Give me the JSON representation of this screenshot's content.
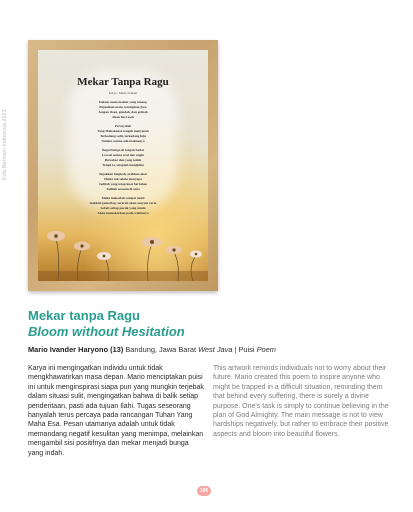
{
  "side_label": "Kids Bermain Indonesia 2023",
  "poster": {
    "title": "Mekar Tanpa Ragu",
    "byline": "Karya : Mario Ivander",
    "stanzas": [
      [
        "Dalam suatu malam yang tenang",
        "Pujanikan mata, tenangkan jiwa",
        "Jangan risau, gundah, dan gelisah",
        "Akan hari esok"
      ],
      [
        "Percayalah",
        "Yang Mahakuasa tengah menyusun",
        "Terkadang sulit, terkadang lulu",
        "Namun semua ada maknanya"
      ],
      [
        "Bagai bunga di tengah badai",
        "Lewati semua aral dan angin",
        "Bersabar dan yang teduh",
        "Tetapi ia, tetaplah mengkilat"
      ],
      [
        "Tegakkan langkah, arahkan akar",
        "Dunia tak selalu menyapa",
        "Jadilah yang tetap kuat bertahan",
        "Jadilah sesuatu di sana"
      ],
      [
        "Maka mekarlah sampai nanti",
        "mekkah gemerlap, terarah akan senyum ceria",
        "Sebab setiap pucuk yang muda",
        "Akan memekarkan pada waktunya"
      ]
    ]
  },
  "title": "Mekar tanpa Ragu",
  "subtitle": "Bloom without Hesitation",
  "author": {
    "name": "Mario Ivander Haryono (13)",
    "location": "Bandung, Jawa Barat",
    "location_en": "West Java",
    "separator": "|",
    "genre": "Puisi",
    "genre_en": "Poem"
  },
  "description_id": "Karya ini mengingatkan individu untuk tidak mengkhawatirkan masa depan. Mario menciptakan puisi ini untuk menginspirasi siapa pun yang mungkin terjebak dalam situasi sulit, mengingatkan bahwa di balik setiap penderitaan, pasti ada tujuan Ilahi. Tugas seseorang hanyalah terus percaya pada rancangan Tuhan Yang Maha Esa. Pesan utamanya adalah untuk tidak memandang negatif kesulitan yang menimpa, melainkan mengambil sisi positifnya dan mekar menjadi bunga yang indah.",
  "description_en": "This artwork reminds individuals not to worry about their future. Mario created this poem to inspire anyone who might be trapped in a difficult situation, reminding them that behind every suffering, there is surely a divine purpose. One's task is simply to continue believing in the plan of God Almighty. The main message is not to view hardships negatively, but rather to embrace their positive aspects and bloom into beautiful flowers.",
  "page_number": "196",
  "colors": {
    "accent": "#2a9d8f",
    "badge": "#f4a6a0",
    "frame": "#c8a36f"
  }
}
